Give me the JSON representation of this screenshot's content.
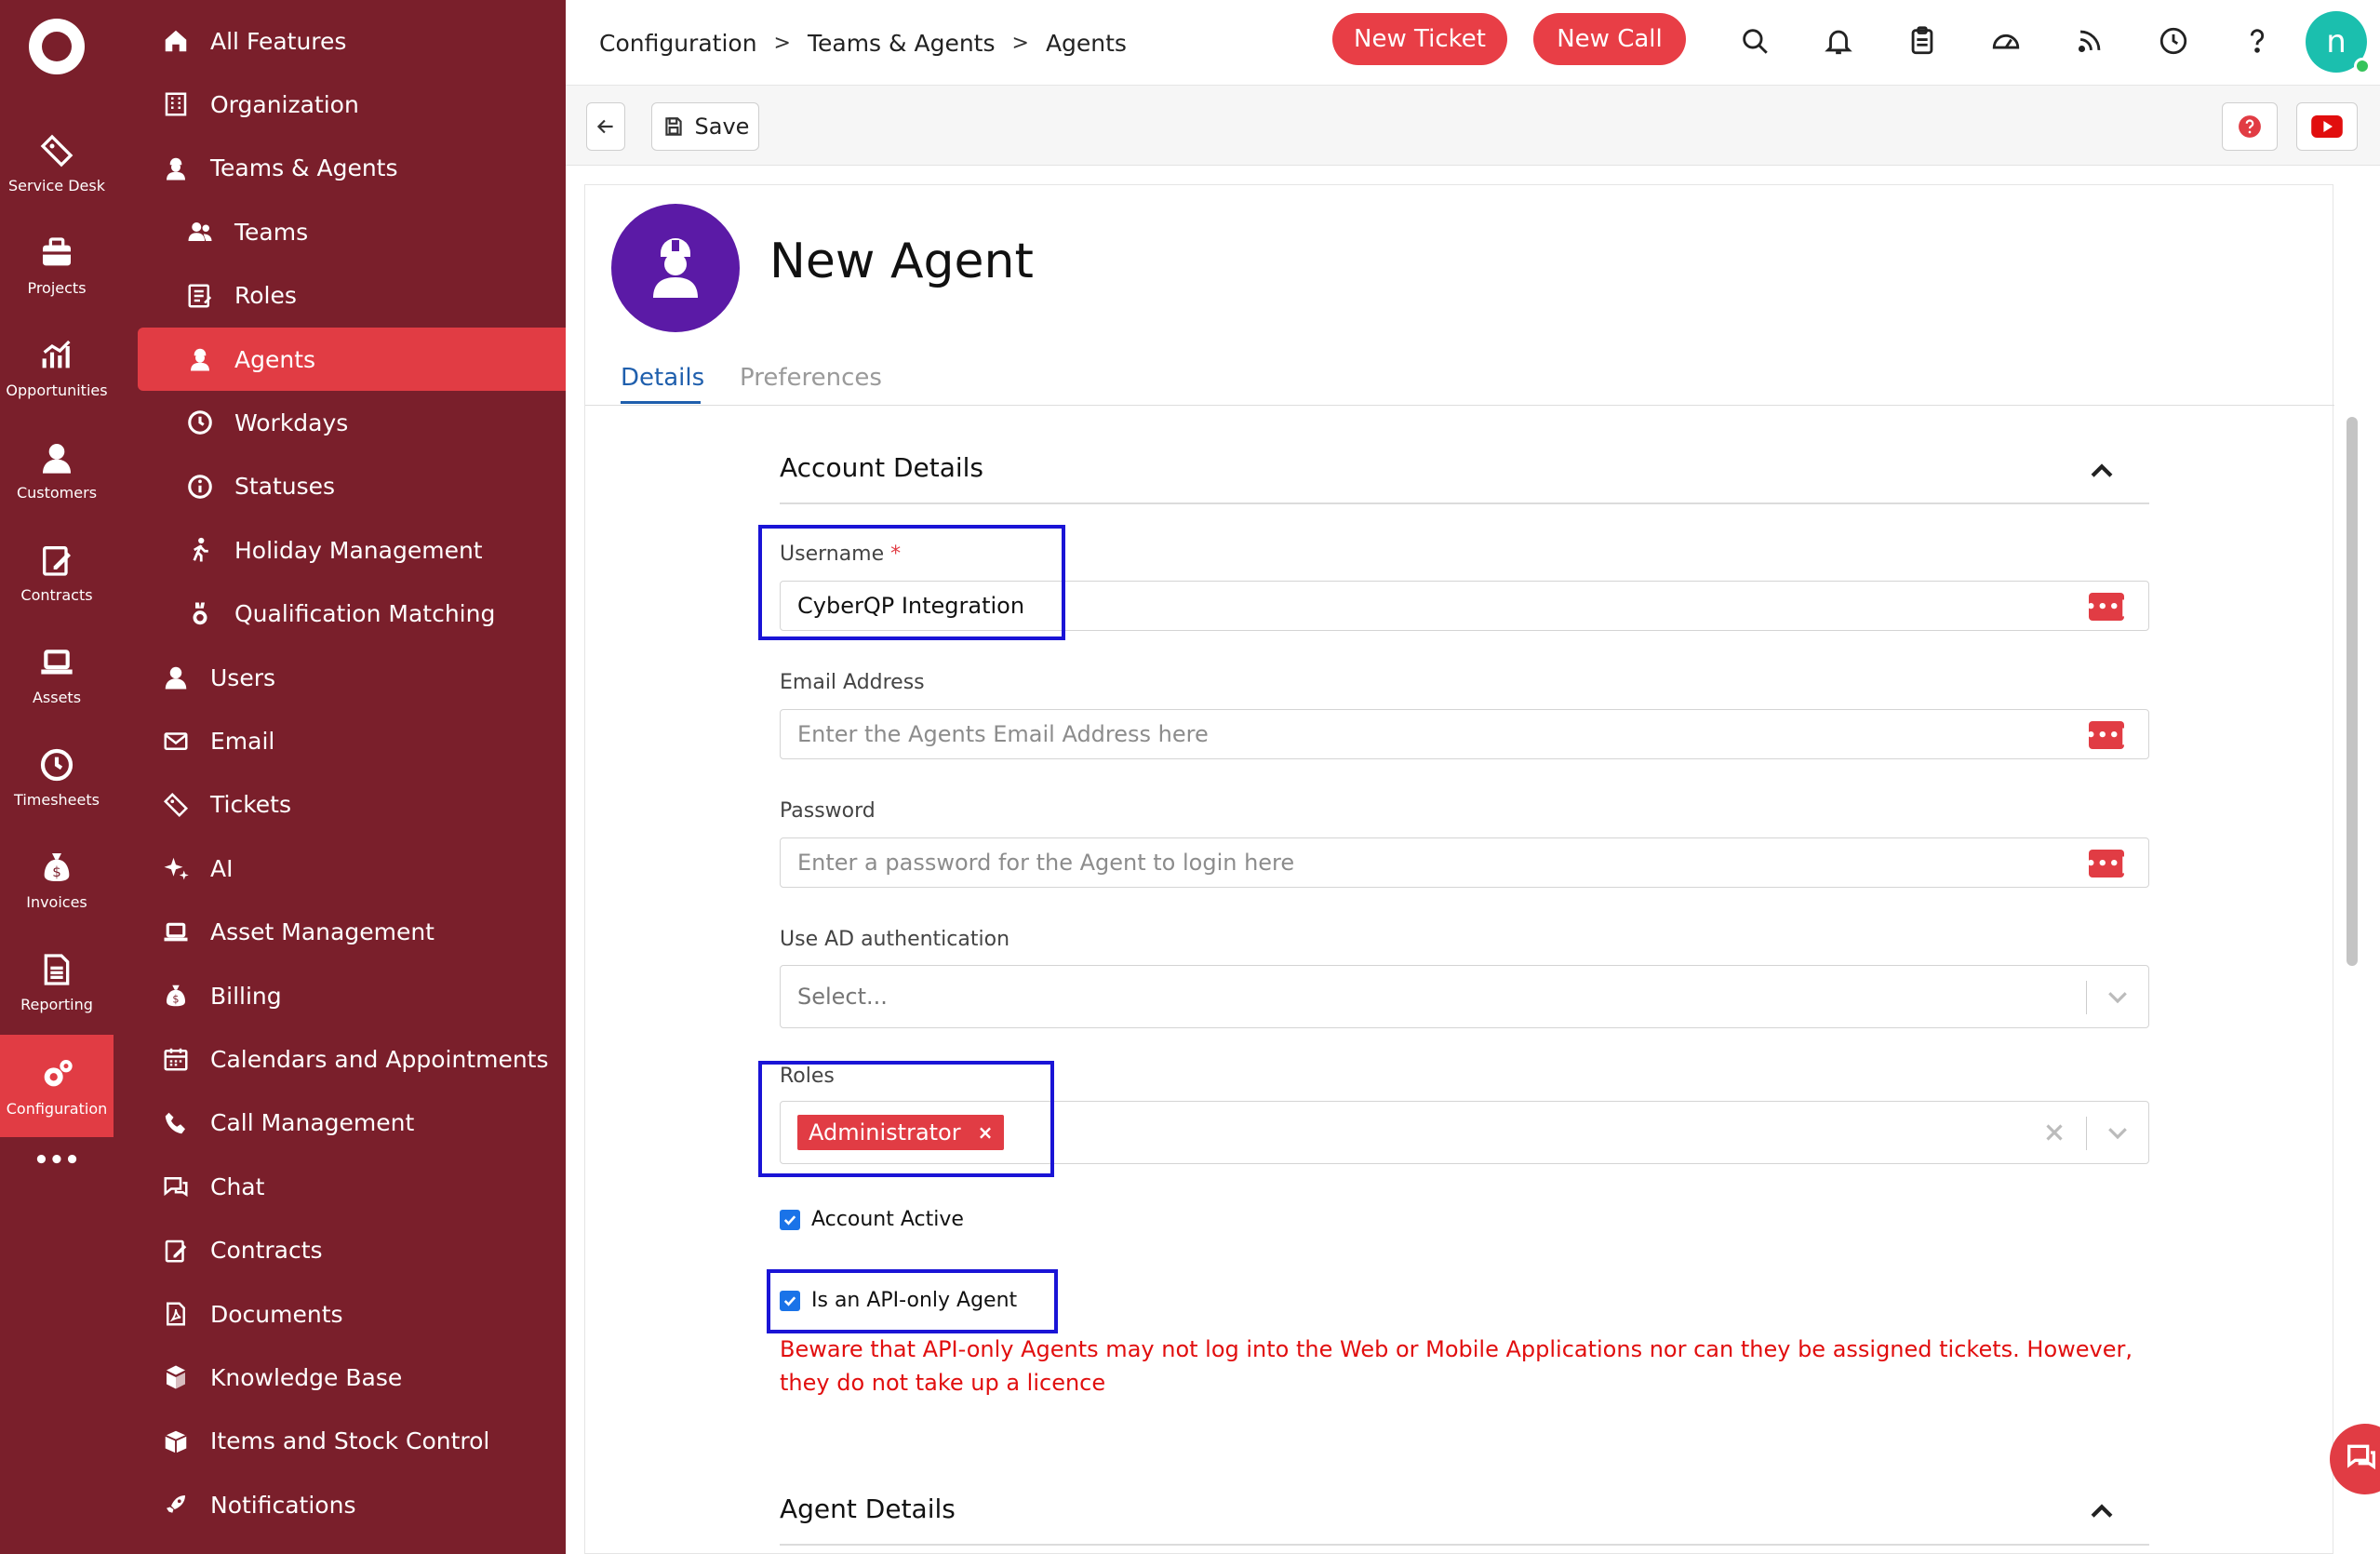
{
  "colors": {
    "rail_bg": "#7a1f2b",
    "sidebar_bg": "#7a1f2b",
    "accent": "#e13c44",
    "tab_active": "#1f5fad",
    "warning": "#e10e0e",
    "highlight_box": "#1a14d6",
    "agent_avatar_bg": "#5b1aa6",
    "user_avatar_bg": "#1bbfae"
  },
  "rail": {
    "items": [
      {
        "label": "Service Desk",
        "icon": "ticket-icon"
      },
      {
        "label": "Projects",
        "icon": "briefcase-icon"
      },
      {
        "label": "Opportunities",
        "icon": "growth-chart-icon"
      },
      {
        "label": "Customers",
        "icon": "person-icon"
      },
      {
        "label": "Contracts",
        "icon": "edit-document-icon"
      },
      {
        "label": "Assets",
        "icon": "laptop-icon"
      },
      {
        "label": "Timesheets",
        "icon": "clock-icon"
      },
      {
        "label": "Invoices",
        "icon": "money-bag-icon"
      },
      {
        "label": "Reporting",
        "icon": "report-icon"
      },
      {
        "label": "Configuration",
        "icon": "gears-icon",
        "active": true
      },
      {
        "label": "•••",
        "icon": "more-icon"
      }
    ]
  },
  "sidebar": {
    "items": [
      {
        "label": "All Features",
        "icon": "home-icon"
      },
      {
        "label": "Organization",
        "icon": "building-icon"
      },
      {
        "label": "Teams & Agents",
        "icon": "agent-icon"
      },
      {
        "label": "Teams",
        "icon": "team-icon",
        "sub": true
      },
      {
        "label": "Roles",
        "icon": "roles-icon",
        "sub": true
      },
      {
        "label": "Agents",
        "icon": "agent-icon",
        "sub": true,
        "active": true
      },
      {
        "label": "Workdays",
        "icon": "clock-icon",
        "sub": true
      },
      {
        "label": "Statuses",
        "icon": "info-icon",
        "sub": true
      },
      {
        "label": "Holiday Management",
        "icon": "walking-icon",
        "sub": true
      },
      {
        "label": "Qualification Matching",
        "icon": "medal-icon",
        "sub": true
      },
      {
        "label": "Users",
        "icon": "person-icon"
      },
      {
        "label": "Email",
        "icon": "email-icon"
      },
      {
        "label": "Tickets",
        "icon": "ticket-icon"
      },
      {
        "label": "AI",
        "icon": "sparkle-icon"
      },
      {
        "label": "Asset Management",
        "icon": "laptop-icon"
      },
      {
        "label": "Billing",
        "icon": "money-bag-icon"
      },
      {
        "label": "Calendars and Appointments",
        "icon": "calendar-icon"
      },
      {
        "label": "Call Management",
        "icon": "phone-icon"
      },
      {
        "label": "Chat",
        "icon": "chat-icon"
      },
      {
        "label": "Contracts",
        "icon": "edit-document-icon"
      },
      {
        "label": "Documents",
        "icon": "pdf-document-icon"
      },
      {
        "label": "Knowledge Base",
        "icon": "boxes-icon"
      },
      {
        "label": "Items and Stock Control",
        "icon": "box-icon"
      },
      {
        "label": "Notifications",
        "icon": "rocket-icon"
      }
    ]
  },
  "topbar": {
    "breadcrumbs": [
      "Configuration",
      "Teams & Agents",
      "Agents"
    ],
    "new_ticket": "New Ticket",
    "new_call": "New Call",
    "avatar_initial": "n"
  },
  "toolbar": {
    "save_label": "Save"
  },
  "page": {
    "title": "New Agent",
    "tabs": [
      "Details",
      "Preferences"
    ]
  },
  "form": {
    "account_section": "Account Details",
    "username_label": "Username",
    "username_required": "*",
    "username_value": "CyberQP Integration",
    "email_label": "Email Address",
    "email_placeholder": "Enter the Agents Email Address here",
    "password_label": "Password",
    "password_placeholder": "Enter a password for the Agent to login here",
    "ad_label": "Use AD authentication",
    "ad_placeholder": "Select...",
    "roles_label": "Roles",
    "roles_tag": "Administrator",
    "account_active_label": "Account Active",
    "account_active_checked": true,
    "api_only_label": "Is an API-only Agent",
    "api_only_checked": true,
    "api_warning": "Beware that API-only Agents may not log into the Web or Mobile Applications nor can they be assigned tickets. However, they do not take up a licence",
    "agent_section": "Agent Details"
  }
}
